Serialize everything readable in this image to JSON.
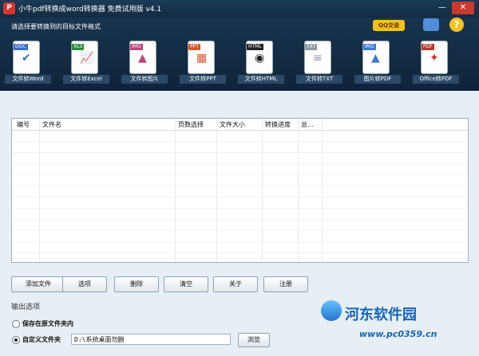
{
  "window": {
    "title": "小牛pdf转换成word转换器 免费试用版 v4.1",
    "logo_glyph": "P",
    "min_glyph": "—",
    "close_glyph": "✕"
  },
  "toolbar": {
    "prompt": "请选择要转换到的目标文件格式",
    "qq_label": "QQ交谈",
    "help_glyph": "?",
    "tools": [
      {
        "tag": "DOC",
        "label": "文件转Word",
        "color": "#3a6fc4",
        "glyph": "✔"
      },
      {
        "tag": "XLS",
        "label": "文件转Excel",
        "color": "#2f8a3e",
        "glyph": "📈"
      },
      {
        "tag": "IMG",
        "label": "文件转图片",
        "color": "#c0437a",
        "glyph": "▲"
      },
      {
        "tag": "PPT",
        "label": "文件转PPT",
        "color": "#d2562d",
        "glyph": "▦"
      },
      {
        "tag": "HTML",
        "label": "文件转HTML",
        "color": "#222222",
        "glyph": "◉"
      },
      {
        "tag": "TXT",
        "label": "文件转TXT",
        "color": "#8e9aa6",
        "glyph": "≡"
      },
      {
        "tag": "IMG",
        "label": "图片转PDF",
        "color": "#3a7ccc",
        "glyph": "▲"
      },
      {
        "tag": "PDF",
        "label": "Office转PDF",
        "color": "#b8392d",
        "glyph": "✦"
      }
    ]
  },
  "table": {
    "columns": [
      "编号",
      "文件名",
      "页数选择",
      "文件大小",
      "转换进度",
      "总..."
    ]
  },
  "buttons": {
    "add": "添加文件",
    "options": "选项",
    "delete": "删除",
    "clear": "清空",
    "about": "关于",
    "register": "注册",
    "browse": "浏览"
  },
  "output": {
    "title": "输出选项",
    "save_original": "保存在原文件夹内",
    "custom_folder": "自定义文件夹",
    "path": "D:\\系统桌面勿删"
  },
  "watermark": {
    "name": "河东软件园",
    "url": "www.pc0359.cn"
  }
}
